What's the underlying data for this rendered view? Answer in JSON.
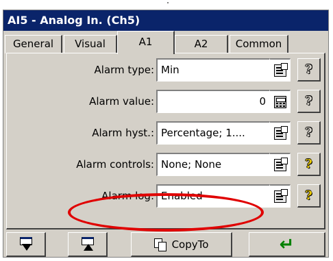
{
  "window": {
    "title": "AI5 - Analog In. (Ch5)"
  },
  "tabs": [
    {
      "label": "General"
    },
    {
      "label": "Visual"
    },
    {
      "label": "A1"
    },
    {
      "label": "A2"
    },
    {
      "label": "Common"
    }
  ],
  "active_tab": "A1",
  "rows": [
    {
      "label": "Alarm type:",
      "value": "Min",
      "edit_icon": "properties-icon",
      "help_style": "plain"
    },
    {
      "label": "Alarm value:",
      "value": "0",
      "edit_icon": "calculator-icon",
      "help_style": "plain"
    },
    {
      "label": "Alarm hyst.:",
      "value": "Percentage; 1....",
      "edit_icon": "properties-icon",
      "help_style": "plain"
    },
    {
      "label": "Alarm controls:",
      "value": "None; None",
      "edit_icon": "properties-icon",
      "help_style": "yellow"
    },
    {
      "label": "Alarm log:",
      "value": "Enabled",
      "edit_icon": "properties-icon",
      "help_style": "yellow"
    }
  ],
  "help_glyph": "?",
  "bottom": {
    "copy_label": "CopyTo",
    "enter_glyph": "↵"
  },
  "colors": {
    "titlebar": "#0a246a",
    "highlight": "#e00000",
    "help_yellow": "#e8c800",
    "enter_green": "#008000"
  }
}
